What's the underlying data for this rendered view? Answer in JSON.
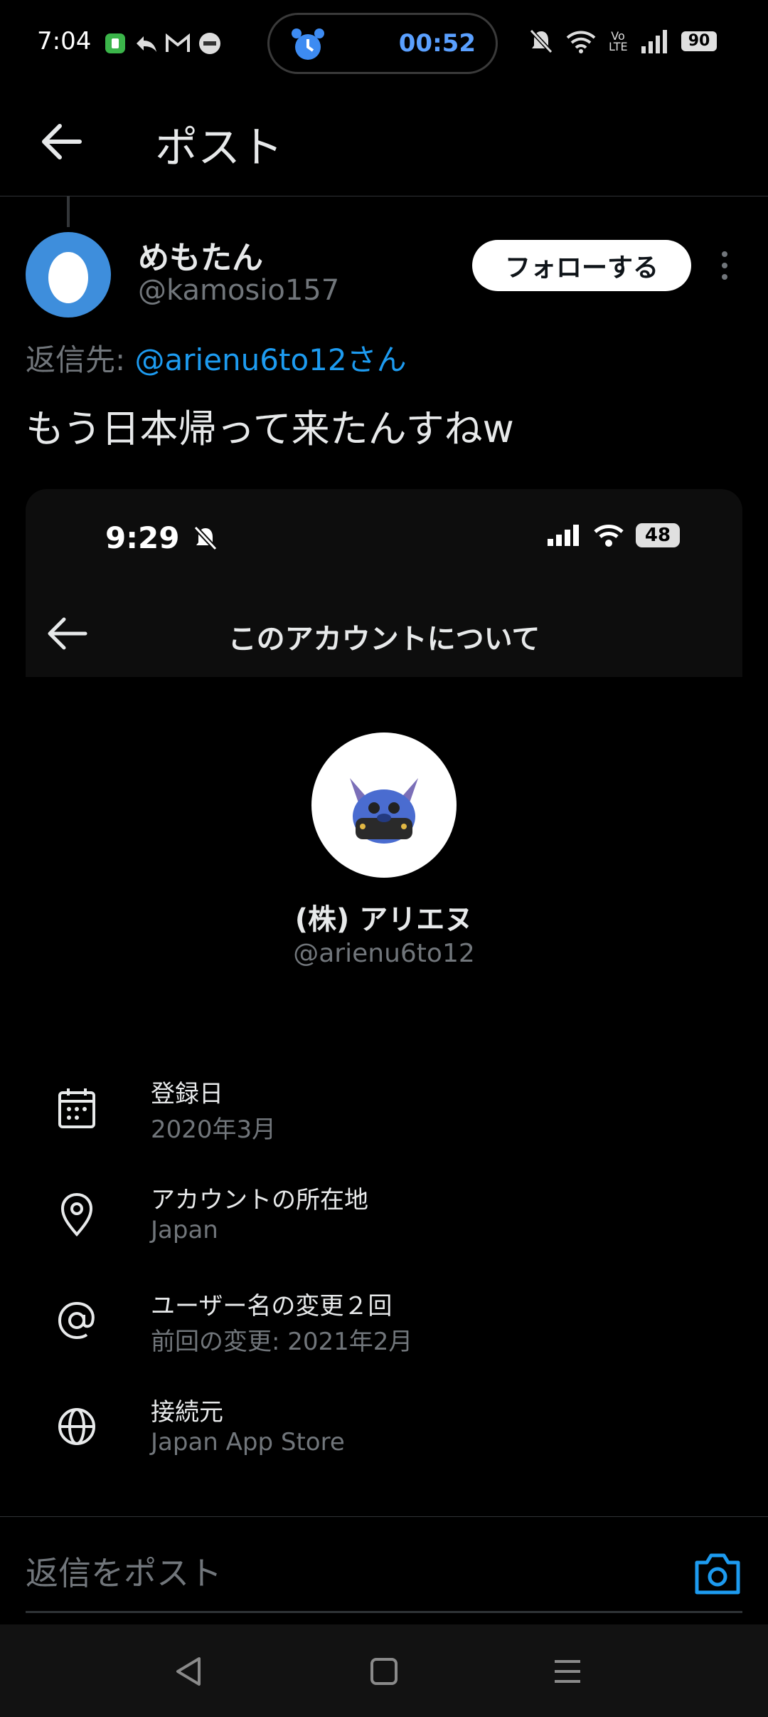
{
  "status_bar": {
    "time": "7:04",
    "timer": "00:52",
    "battery": "90",
    "volte": "Vo LTE",
    "icons_left": [
      "app-notification-icon",
      "reply-arrow-icon",
      "gmail-icon",
      "news-icon"
    ],
    "icons_right": [
      "mute-bell-icon",
      "wifi-icon",
      "volte-icon",
      "signal-icon",
      "battery-icon"
    ]
  },
  "header": {
    "title": "ポスト"
  },
  "post": {
    "author_name": "めもたん",
    "author_handle": "@kamosio157",
    "follow_label": "フォローする",
    "reply_prefix": "返信先: ",
    "reply_mention": "@arienu6to12さん",
    "text": "もう日本帰って来たんすねw"
  },
  "media": {
    "status_time": "9:29",
    "status_battery": "48",
    "title": "このアカウントについて",
    "account_name": "(株) アリエヌ",
    "account_handle": "@arienu6to12",
    "rows": [
      {
        "icon": "calendar-icon",
        "label": "登録日",
        "value": "2020年3月"
      },
      {
        "icon": "location-pin-icon",
        "label": "アカウントの所在地",
        "value": "Japan"
      },
      {
        "icon": "at-sign-icon",
        "label": "ユーザー名の変更２回",
        "value": "前回の変更: 2021年2月"
      },
      {
        "icon": "globe-icon",
        "label": "接続元",
        "value": "Japan App Store"
      }
    ]
  },
  "composer": {
    "placeholder": "返信をポスト"
  },
  "colors": {
    "accent": "#1d9bf0",
    "background": "#000000",
    "muted": "#71767b",
    "avatar_bg": "#3e8edc"
  }
}
